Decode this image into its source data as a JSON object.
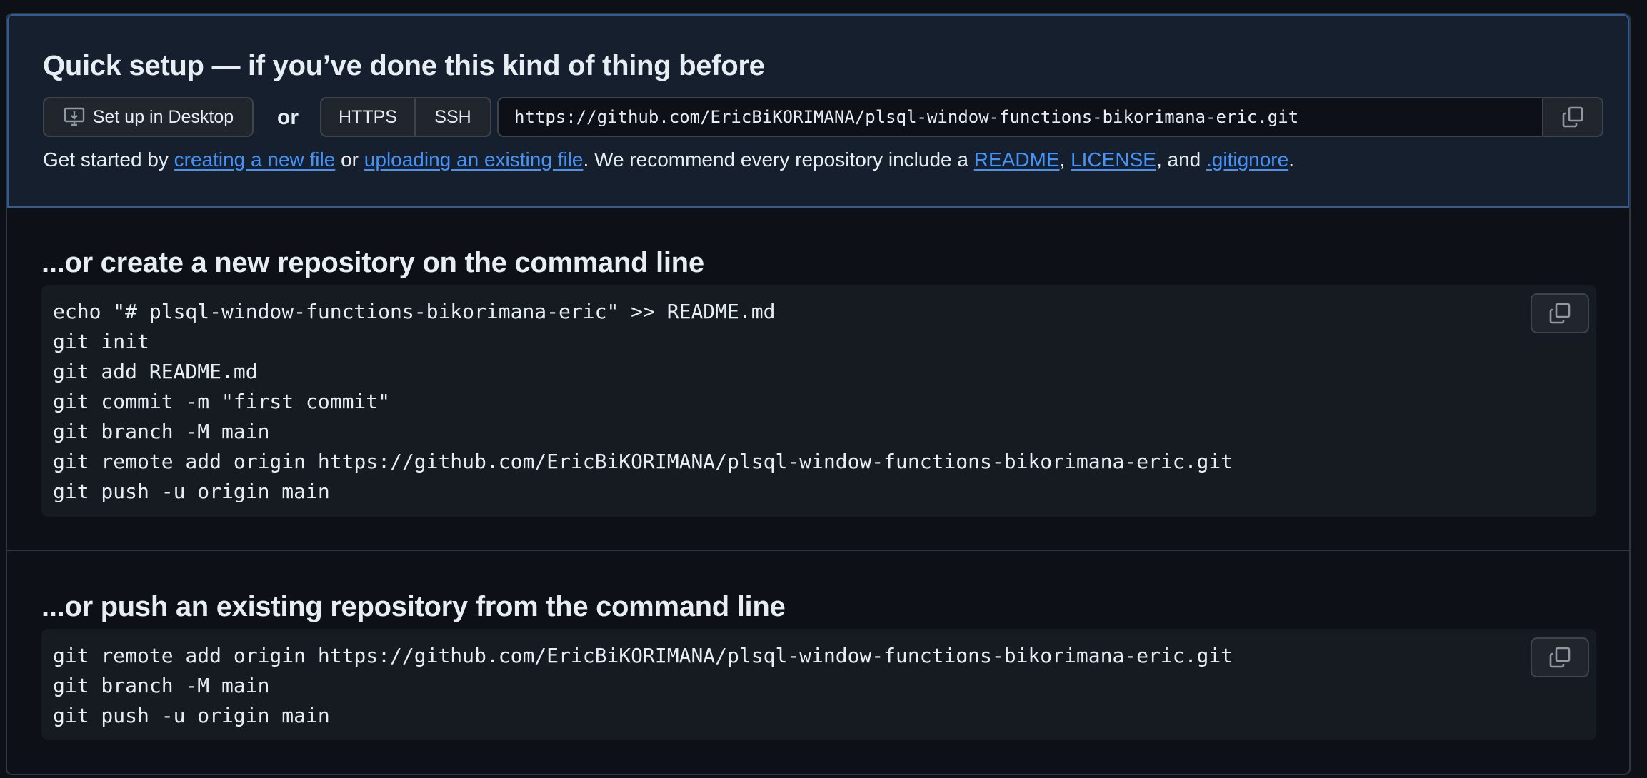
{
  "quick_setup": {
    "title": "Quick setup — if you’ve done this kind of thing before",
    "desktop_button_label": "Set up in Desktop",
    "or_label": "or",
    "protocol_options": [
      "HTTPS",
      "SSH"
    ],
    "selected_protocol": "HTTPS",
    "clone_url": "https://github.com/EricBiKORIMANA/plsql-window-functions-bikorimana-eric.git",
    "copy_icon": "copy-icon",
    "desktop_icon": "desktop-download-icon",
    "help": {
      "prefix": "Get started by ",
      "link_new_file": "creating a new file",
      "or": " or ",
      "link_upload": "uploading an existing file",
      "middle": ". We recommend every repository include a ",
      "link_readme": "README",
      "comma": ", ",
      "link_license": "LICENSE",
      "and": ", and ",
      "link_gitignore": ".gitignore",
      "end": "."
    }
  },
  "new_repo": {
    "title": "...or create a new repository on the command line",
    "lines": [
      "echo \"# plsql-window-functions-bikorimana-eric\" >> README.md",
      "git init",
      "git add README.md",
      "git commit -m \"first commit\"",
      "git branch -M main",
      "git remote add origin https://github.com/EricBiKORIMANA/plsql-window-functions-bikorimana-eric.git",
      "git push -u origin main"
    ]
  },
  "push_existing": {
    "title": "...or push an existing repository from the command line",
    "lines": [
      "git remote add origin https://github.com/EricBiKORIMANA/plsql-window-functions-bikorimana-eric.git",
      "git branch -M main",
      "git push -u origin main"
    ]
  },
  "colors": {
    "background": "#0d1117",
    "panel_highlight": "#161f2e",
    "panel_border": "#2f5c9c",
    "link": "#4493f8",
    "code_bg": "#161b22",
    "button_bg": "#21262d",
    "border": "#3d444d",
    "text": "#e6edf3"
  }
}
